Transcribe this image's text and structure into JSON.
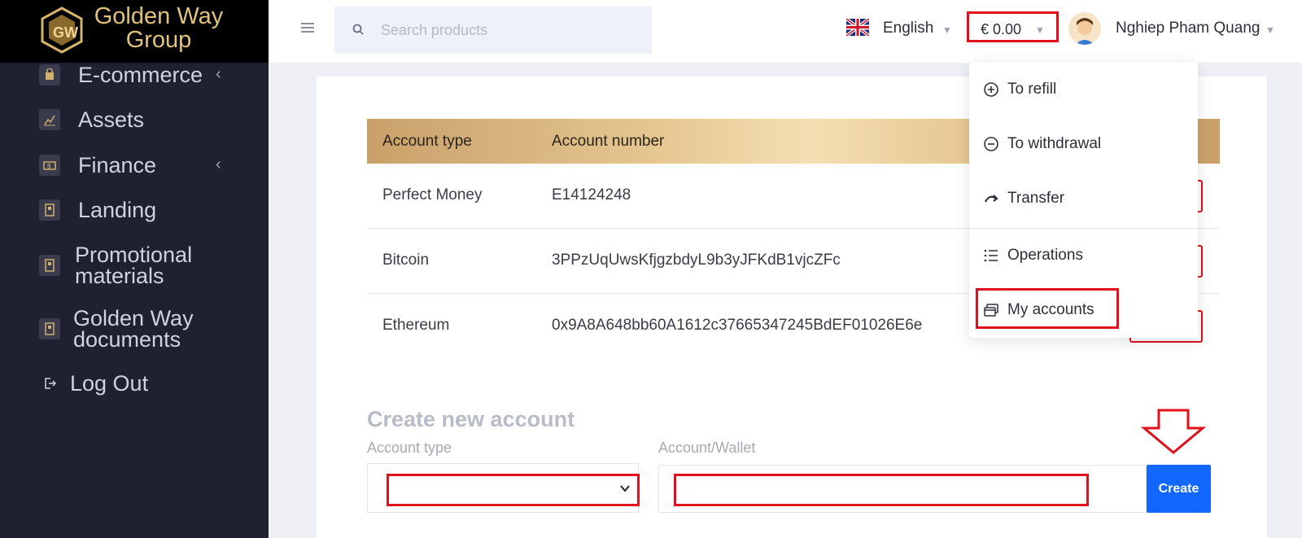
{
  "brand": {
    "line1": "Golden Way",
    "line2": "Group"
  },
  "sidebar": {
    "items": [
      {
        "label": "E-commerce",
        "has_caret": true
      },
      {
        "label": "Assets",
        "has_caret": false
      },
      {
        "label": "Finance",
        "has_caret": true
      },
      {
        "label": "Landing",
        "has_caret": false
      },
      {
        "label_line1": "Promotional",
        "label_line2": "materials"
      },
      {
        "label_line1": "Golden Way",
        "label_line2": "documents"
      },
      {
        "label": "Log Out"
      }
    ]
  },
  "header": {
    "search_placeholder": "Search products",
    "language": "English",
    "balance": "€ 0.00",
    "user_name": "Nghiep Pham Quang"
  },
  "user_menu": {
    "items": [
      {
        "label": "To refill",
        "icon": "plus-circle-icon"
      },
      {
        "label": "To withdrawal",
        "icon": "minus-circle-icon"
      },
      {
        "label": "Transfer",
        "icon": "transfer-arrow-icon"
      },
      {
        "label": "Operations",
        "icon": "list-icon"
      },
      {
        "label": "My accounts",
        "icon": "cards-icon"
      }
    ]
  },
  "accounts_table": {
    "headers": [
      "Account type",
      "Account number"
    ],
    "rows": [
      {
        "type": "Perfect Money",
        "number": "E14124248"
      },
      {
        "type": "Bitcoin",
        "number": "3PPzUqUwsKfjgzbdyL9b3yJFKdB1vjcZFc"
      },
      {
        "type": "Ethereum",
        "number": "0x9A8A648bb60A1612c37665347245BdEF01026E6e"
      }
    ]
  },
  "create_form": {
    "title": "Create new account",
    "account_type_label": "Account type",
    "wallet_label": "Account/Wallet",
    "create_button": "Create"
  },
  "colors": {
    "sidebar_bg": "#1f2030",
    "highlight_red": "#e0101c",
    "primary_blue": "#1167ff",
    "gold": "#e0c27a"
  }
}
